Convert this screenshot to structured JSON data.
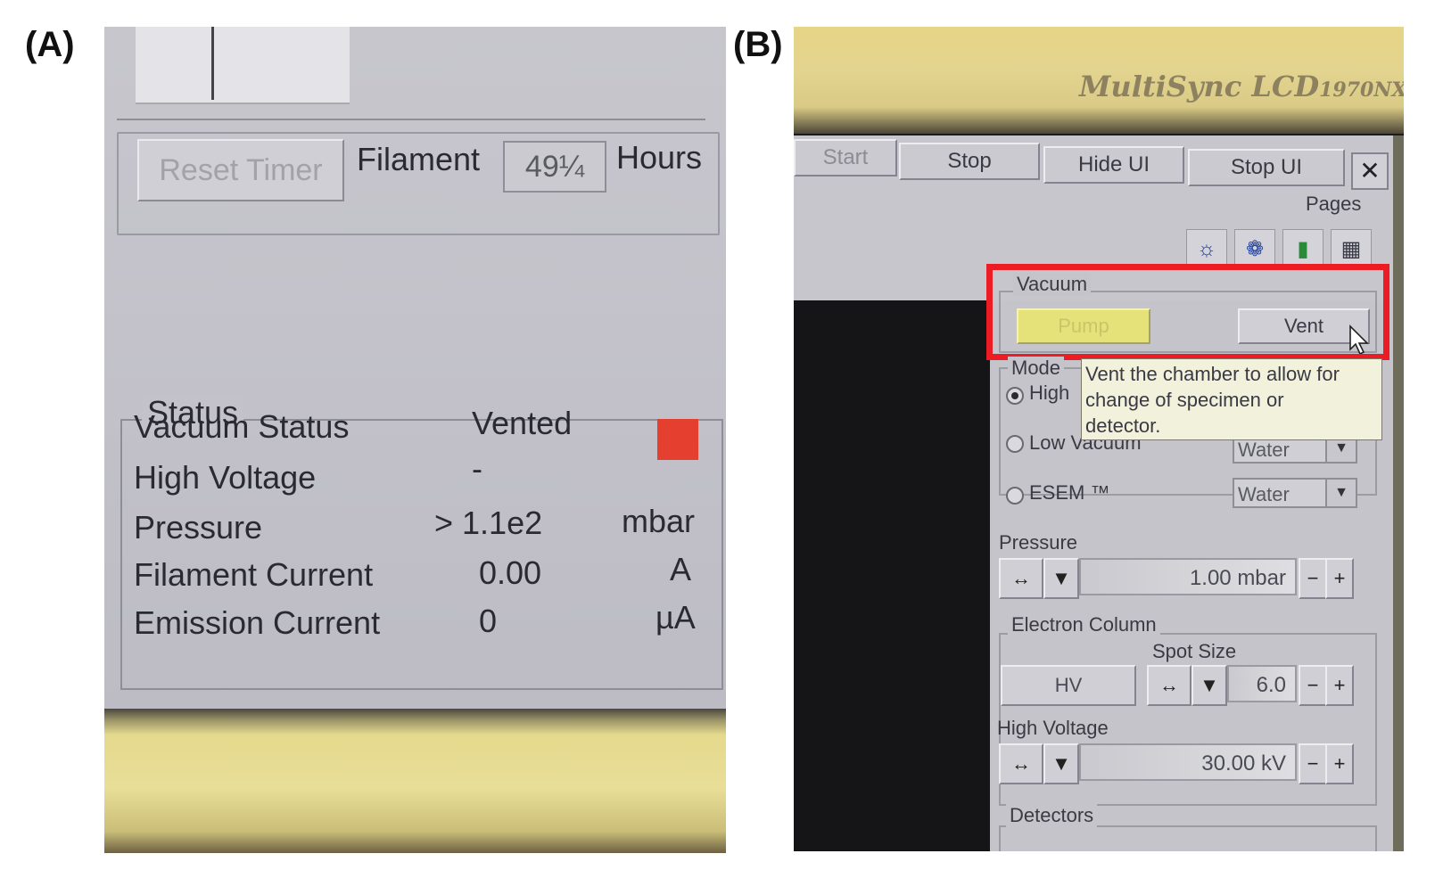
{
  "labels": {
    "a": "(A)",
    "b": "(B)"
  },
  "panel_a": {
    "reset_timer": "Reset Timer",
    "filament_label": "Filament",
    "filament_value": "49¼",
    "hours_label": "Hours",
    "status_title": "Status",
    "status_color": "#e53f30",
    "rows": [
      {
        "label": "Vacuum Status",
        "value": "Vented",
        "unit": ""
      },
      {
        "label": "High Voltage",
        "value": "-",
        "unit": ""
      },
      {
        "label": "Pressure",
        "value": "> 1.1e2",
        "unit": "mbar"
      },
      {
        "label": "Filament Current",
        "value": "0.00",
        "unit": "A"
      },
      {
        "label": "Emission Current",
        "value": "0",
        "unit": "µA"
      }
    ]
  },
  "panel_b": {
    "brand": "MultiSync LCD",
    "brand_model": "1970NX",
    "toolbar": [
      "Start",
      "Stop",
      "Hide UI",
      "Stop UI"
    ],
    "close": "✕",
    "pages_label": "Pages",
    "vacuum": {
      "title": "Vacuum",
      "pump": "Pump",
      "vent": "Vent"
    },
    "tooltip": [
      "Vent the chamber to allow for",
      "change of specimen or",
      "detector."
    ],
    "mode": {
      "title": "Mode",
      "high": "High",
      "low": "Low Vacuum",
      "esem": "ESEM ™",
      "low_gas": "Water",
      "esem_gas": "Water"
    },
    "pressure": {
      "label": "Pressure",
      "value": "1.00  mbar"
    },
    "column": {
      "title": "Electron Column",
      "spot_label": "Spot Size",
      "hv_button": "HV",
      "spot_value": "6.0",
      "hv_label": "High Voltage",
      "hv_value": "30.00 kV"
    },
    "detectors_title": "Detectors",
    "highlight_color": "#ec1c24",
    "pump_color": "#e6e27a"
  }
}
